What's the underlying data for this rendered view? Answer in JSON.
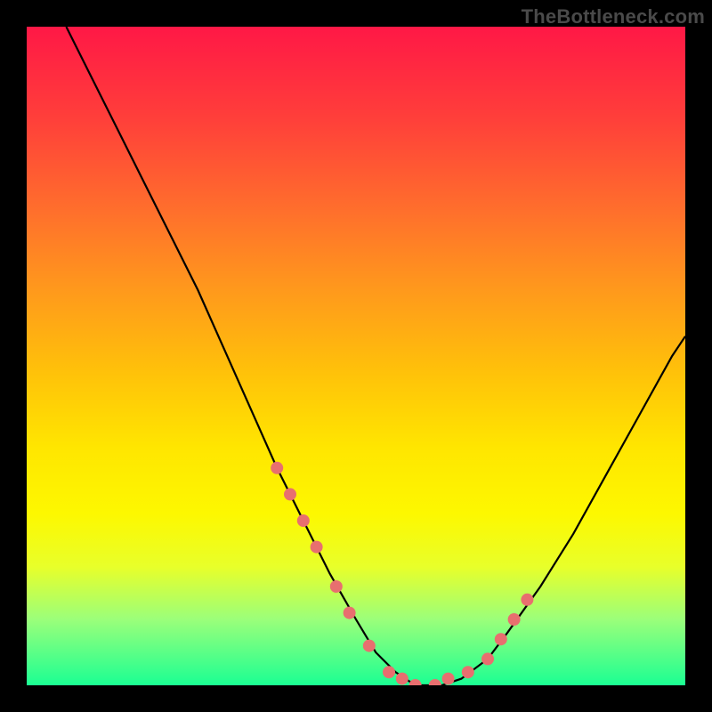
{
  "watermark": "TheBottleneck.com",
  "chart_data": {
    "type": "line",
    "title": "",
    "xlabel": "",
    "ylabel": "",
    "xlim": [
      0,
      100
    ],
    "ylim": [
      0,
      100
    ],
    "series": [
      {
        "name": "curve",
        "x": [
          6,
          10,
          14,
          18,
          22,
          26,
          30,
          34,
          38,
          42,
          46,
          50,
          53,
          56,
          59,
          63,
          66,
          70,
          73,
          78,
          83,
          88,
          93,
          98,
          100
        ],
        "y": [
          100,
          92,
          84,
          76,
          68,
          60,
          51,
          42,
          33,
          25,
          17,
          10,
          5,
          2,
          0,
          0,
          1,
          4,
          8,
          15,
          23,
          32,
          41,
          50,
          53
        ]
      }
    ],
    "markers": {
      "name": "highlight-dots",
      "x": [
        38,
        40,
        42,
        44,
        47,
        49,
        52,
        55,
        57,
        59,
        62,
        64,
        67,
        70,
        72,
        74,
        76
      ],
      "y": [
        33,
        29,
        25,
        21,
        15,
        11,
        6,
        2,
        1,
        0,
        0,
        1,
        2,
        4,
        7,
        10,
        13
      ]
    }
  }
}
